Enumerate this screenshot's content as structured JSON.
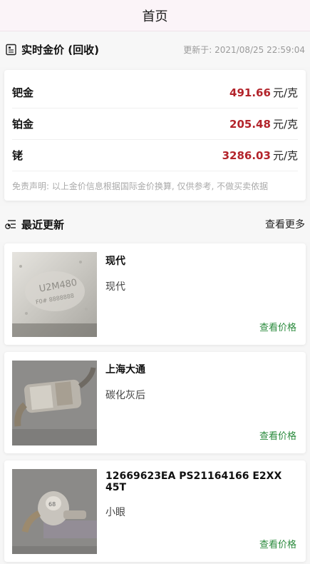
{
  "header": {
    "title": "首页"
  },
  "gold": {
    "section_title": "实时金价 (回收)",
    "updated_label": "更新于: 2021/08/25 22:59:04",
    "rows": [
      {
        "metal": "钯金",
        "value": "491.66",
        "unit": "元/克"
      },
      {
        "metal": "铂金",
        "value": "205.48",
        "unit": "元/克"
      },
      {
        "metal": "铑",
        "value": "3286.03",
        "unit": "元/克"
      }
    ],
    "disclaimer": "免责声明: 以上金价信息根据国际金价换算, 仅供参考, 不做买卖依据"
  },
  "recent": {
    "section_title": "最近更新",
    "more_label": "查看更多",
    "items": [
      {
        "name": "现代",
        "desc": "现代",
        "link": "查看价格"
      },
      {
        "name": "上海大通",
        "desc": "碳化灰后",
        "link": "查看价格"
      },
      {
        "name": "12669623EA PS21164166 E2XX 45T",
        "desc": "小眼",
        "link": "查看价格"
      }
    ]
  },
  "colors": {
    "price": "#b3242b",
    "link": "#2a8a3c"
  }
}
